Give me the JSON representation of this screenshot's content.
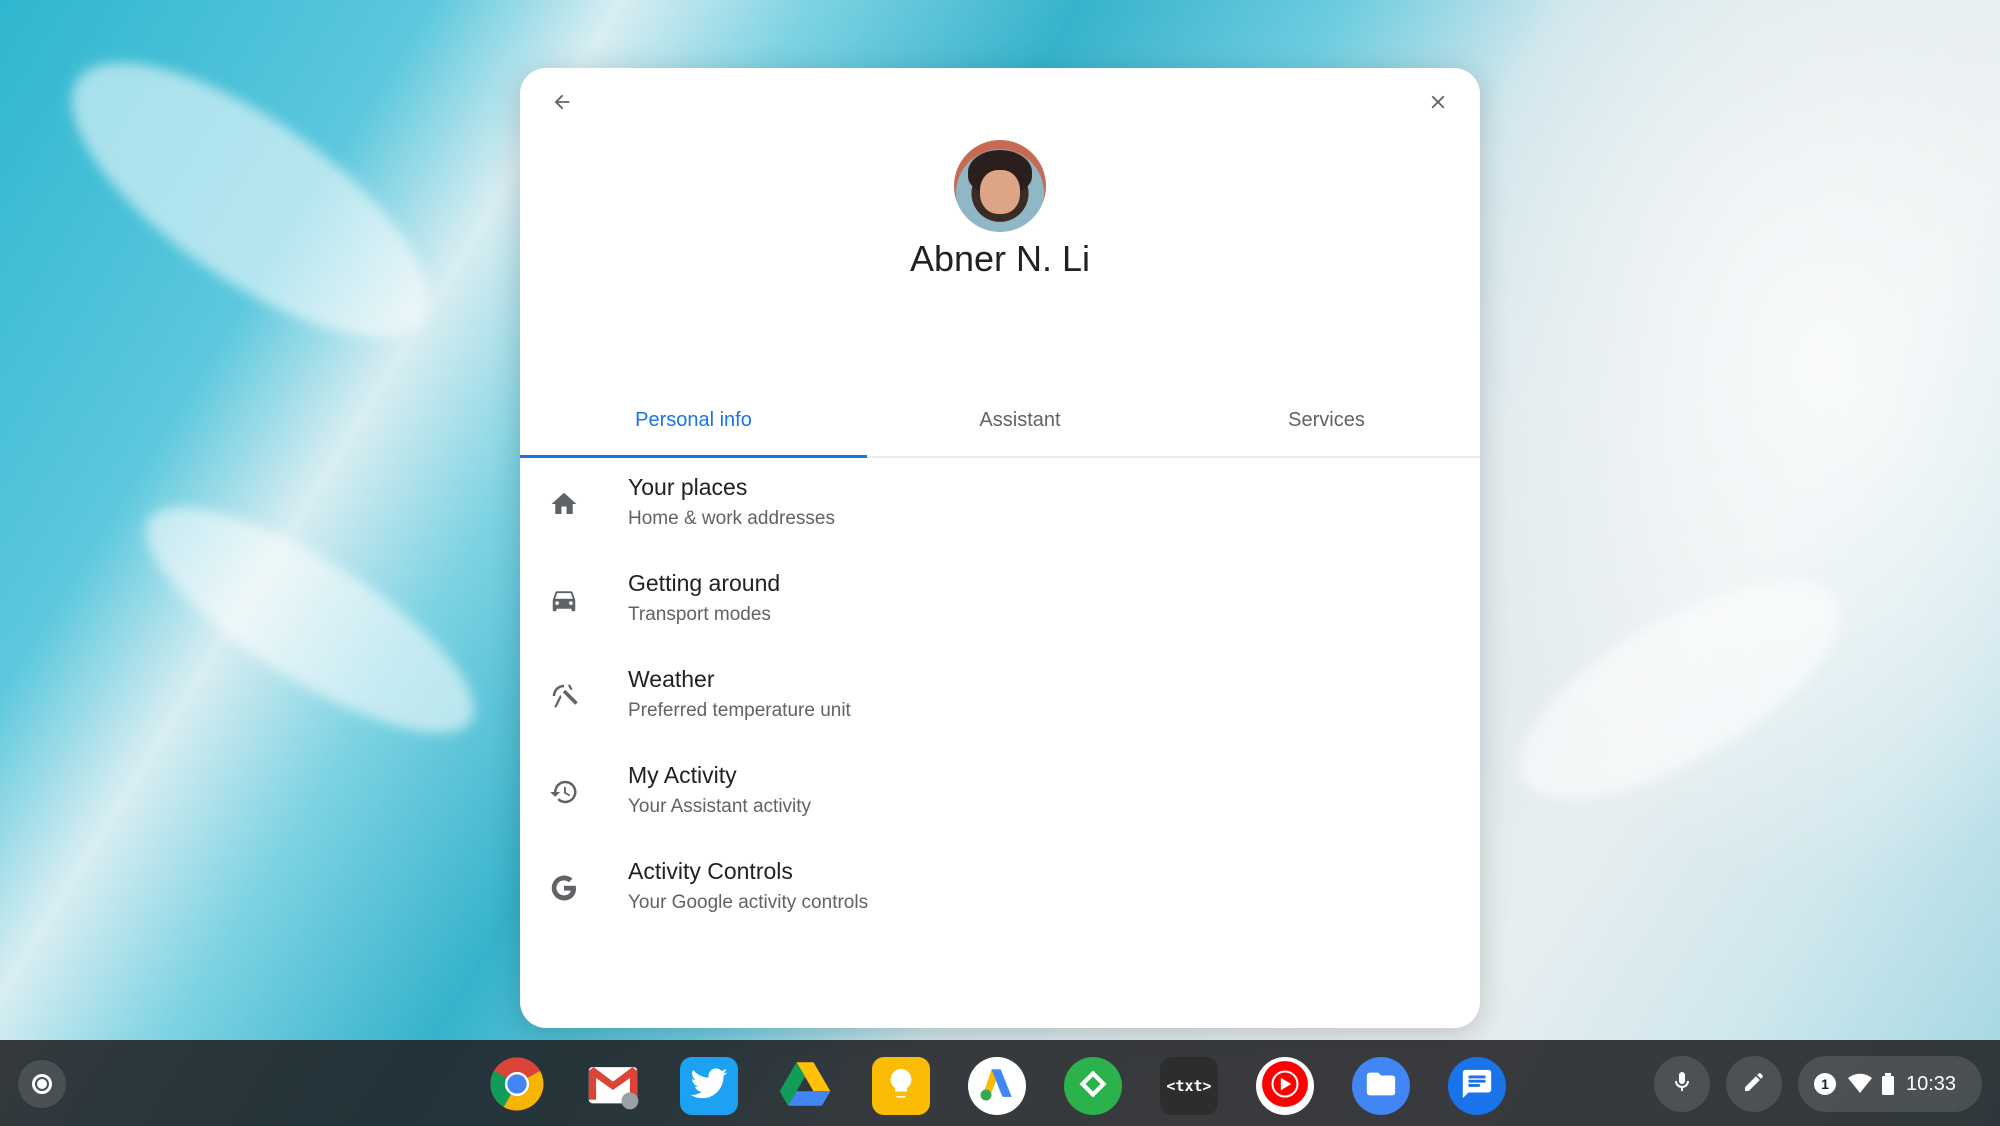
{
  "dialog": {
    "user_name": "Abner N. Li",
    "tabs": [
      {
        "label": "Personal info",
        "active": true
      },
      {
        "label": "Assistant",
        "active": false
      },
      {
        "label": "Services",
        "active": false
      }
    ],
    "items": [
      {
        "title": "Your places",
        "subtitle": "Home & work addresses",
        "icon": "home-icon"
      },
      {
        "title": "Getting around",
        "subtitle": "Transport modes",
        "icon": "car-icon"
      },
      {
        "title": "Weather",
        "subtitle": "Preferred temperature unit",
        "icon": "weather-icon"
      },
      {
        "title": "My Activity",
        "subtitle": "Your Assistant activity",
        "icon": "history-icon"
      },
      {
        "title": "Activity Controls",
        "subtitle": "Your Google activity controls",
        "icon": "google-g-icon"
      }
    ]
  },
  "shelf": {
    "apps": [
      "chrome",
      "gmail",
      "twitter",
      "google-drive",
      "google-keep",
      "google-ads",
      "feedly",
      "text-editor",
      "youtube-music",
      "files",
      "messages"
    ],
    "txt_label": "<txt>",
    "notification_count": "1",
    "time": "10:33"
  },
  "colors": {
    "accent": "#1a73e8",
    "text_primary": "#202124",
    "text_secondary": "#5f6368"
  }
}
